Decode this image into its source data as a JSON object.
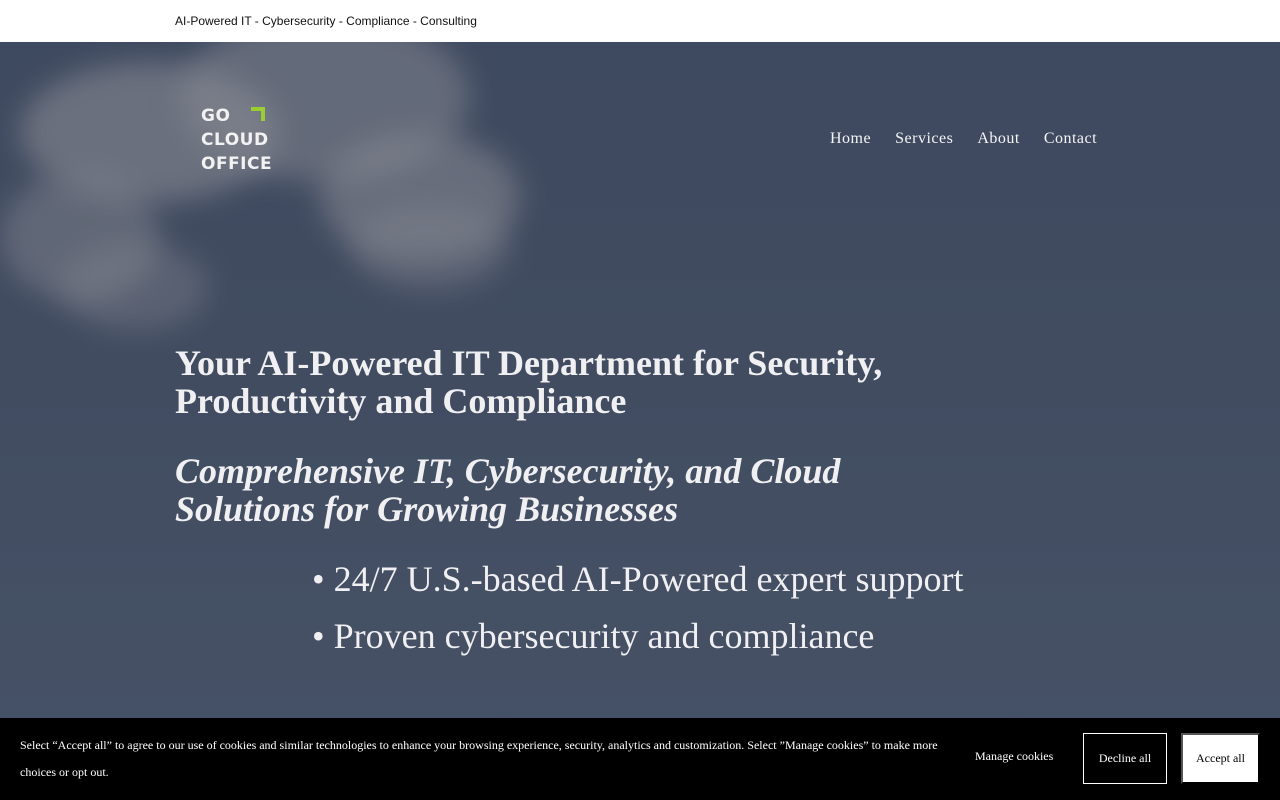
{
  "topbar": {
    "tagline": "AI-Powered IT - Cybersecurity - Compliance - Consulting"
  },
  "logo": {
    "line1": "GO",
    "line2": "CLOUD",
    "line3": "OFFICE",
    "accent_color": "#9acd32"
  },
  "nav": {
    "items": [
      {
        "label": "Home"
      },
      {
        "label": "Services"
      },
      {
        "label": "About"
      },
      {
        "label": "Contact"
      }
    ]
  },
  "hero": {
    "headline": "Your AI-Powered IT Department for Security, Productivity and Compliance",
    "subheadline": "Comprehensive IT, Cybersecurity, and Cloud Solutions for Growing Businesses",
    "bullets": [
      "• 24/7 U.S.-based AI-Powered expert support",
      "• Proven cybersecurity and compliance"
    ]
  },
  "cookie_banner": {
    "text": "Select “Accept all” to agree to our use of cookies and similar technologies to enhance your browsing experience, security, analytics and customization. Select ”Manage cookies” to make more choices or opt out.",
    "manage_label": "Manage cookies",
    "decline_label": "Decline all",
    "accept_label": "Accept all"
  }
}
